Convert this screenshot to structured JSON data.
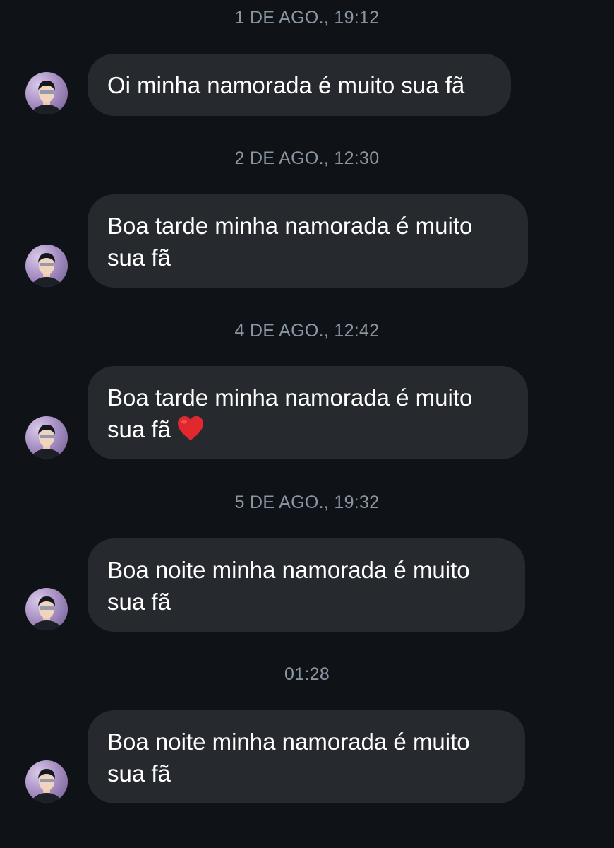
{
  "messages": [
    {
      "timestamp": "1 DE AGO., 19:12",
      "text": "Oi minha namorada é muito sua fã"
    },
    {
      "timestamp": "2 DE AGO., 12:30",
      "line1": "Boa tarde minha namorada é muito",
      "line2": "sua fã"
    },
    {
      "timestamp": "4 DE AGO., 12:42",
      "line1": "Boa tarde minha namorada é muito",
      "line2": "sua fã",
      "emoji": "heart-icon"
    },
    {
      "timestamp": "5 DE AGO., 19:32",
      "line1": "Boa noite minha namorada é muito",
      "line2": "sua fã"
    },
    {
      "timestamp": "01:28",
      "line1": "Boa noite minha namorada é muito",
      "line2": "sua fã"
    }
  ],
  "colors": {
    "background": "#0f1216",
    "bubble": "#26292e",
    "timestamp": "#8b96a3",
    "text": "#ffffff",
    "heart": "#e0282e"
  }
}
